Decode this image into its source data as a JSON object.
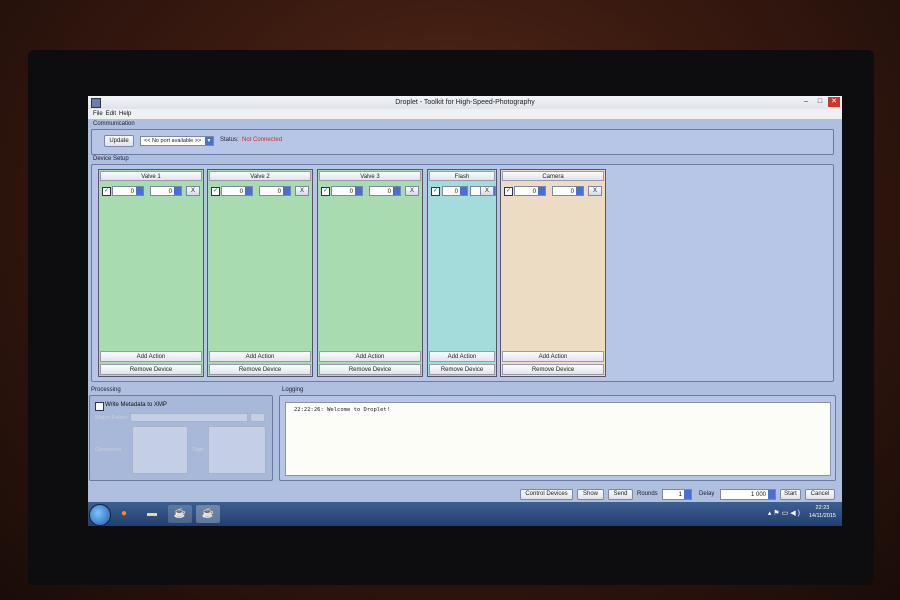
{
  "window": {
    "title": "Droplet - Toolkit for High-Speed-Photography"
  },
  "menu": [
    "File",
    "Edit",
    "Help"
  ],
  "communication": {
    "section_label": "Communication",
    "update_label": "Update",
    "port_value": "<< No port available >>",
    "status_label": "Status:",
    "status_value": "Not Connected",
    "status_color": "#c0302a"
  },
  "device_setup": {
    "section_label": "Device Setup",
    "devices": [
      {
        "name": "Valve 1",
        "val1": "0",
        "val2": "0",
        "color": "#a8dcb0",
        "checked": true
      },
      {
        "name": "Valve 2",
        "val1": "0",
        "val2": "0",
        "color": "#a8dcb0",
        "checked": true
      },
      {
        "name": "Valve 3",
        "val1": "0",
        "val2": "0",
        "color": "#a8dcb0",
        "checked": true
      },
      {
        "name": "Flash",
        "val1": "0",
        "val2": "0",
        "color": "#a4dcdc",
        "checked": true
      },
      {
        "name": "Camera",
        "val1": "0",
        "val2": "0",
        "color": "#ecdcc4",
        "checked": true
      }
    ],
    "remove_label": "X",
    "add_action_label": "Add Action",
    "remove_device_label": "Remove Device"
  },
  "processing": {
    "section_label": "Processing",
    "write_metadata_label": "Write Metadata to XMP",
    "watch_folder_label": "Watch Folder",
    "comments_label": "Comments",
    "tags_label": "Tags"
  },
  "logging": {
    "section_label": "Logging",
    "log_text": "22:22:26: Welcome to Droplet!"
  },
  "controls": {
    "control_devices_label": "Control Devices",
    "show_label": "Show",
    "send_label": "Send",
    "rounds_label": "Rounds",
    "rounds_value": "1",
    "delay_label": "Delay",
    "delay_value": "1 000",
    "start_label": "Start",
    "cancel_label": "Cancel"
  },
  "taskbar": {
    "time": "22:23",
    "date": "14/11/2015",
    "accent": "#2a4a7c"
  }
}
